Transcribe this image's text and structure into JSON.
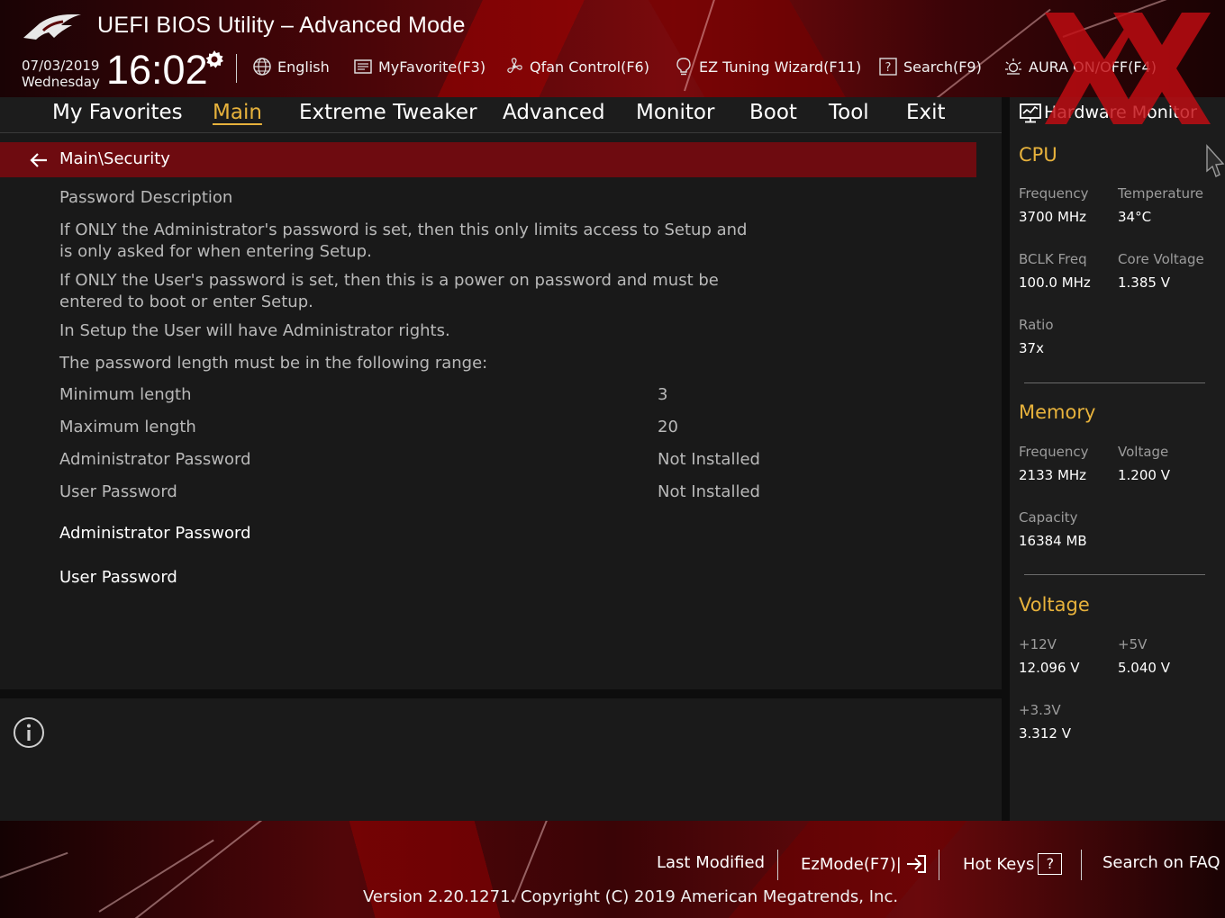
{
  "header": {
    "title": "UEFI BIOS Utility – Advanced Mode",
    "date": "07/03/2019",
    "weekday": "Wednesday",
    "time": "16:02",
    "tools": [
      {
        "label": "English",
        "icon": "globe-icon"
      },
      {
        "label": "MyFavorite(F3)",
        "icon": "favorite-list-icon"
      },
      {
        "label": "Qfan Control(F6)",
        "icon": "fan-icon"
      },
      {
        "label": "EZ Tuning Wizard(F11)",
        "icon": "lightbulb-icon"
      },
      {
        "label": "Search(F9)",
        "icon": "help-box-icon"
      },
      {
        "label": "AURA ON/OFF(F4)",
        "icon": "aura-light-icon"
      }
    ]
  },
  "menu": {
    "items": [
      "My Favorites",
      "Main",
      "Extreme Tweaker",
      "Advanced",
      "Monitor",
      "Boot",
      "Tool",
      "Exit"
    ],
    "active": "Main"
  },
  "main": {
    "breadcrumb": "Main\\Security",
    "description": {
      "title": "Password Description",
      "lines": [
        "If ONLY the Administrator's password is set, then this only limits access to Setup and",
        "is only asked for when entering Setup.",
        "If ONLY the User's password is set, then this is a power on password and must be",
        "entered to boot or enter Setup.",
        "In Setup the User will have Administrator rights.",
        "The password length must be in the following range:"
      ]
    },
    "rows": [
      {
        "label": "Minimum length",
        "value": "3"
      },
      {
        "label": "Maximum length",
        "value": "20"
      },
      {
        "label": "Administrator Password",
        "value": "Not Installed"
      },
      {
        "label": "User Password",
        "value": "Not Installed"
      }
    ],
    "actions": [
      "Administrator Password",
      "User Password"
    ]
  },
  "hardware_monitor": {
    "title": "Hardware Monitor",
    "cpu": {
      "heading": "CPU",
      "frequency_label": "Frequency",
      "frequency": "3700 MHz",
      "temperature_label": "Temperature",
      "temperature": "34°C",
      "bclk_label": "BCLK Freq",
      "bclk": "100.0 MHz",
      "core_voltage_label": "Core Voltage",
      "core_voltage": "1.385 V",
      "ratio_label": "Ratio",
      "ratio": "37x"
    },
    "memory": {
      "heading": "Memory",
      "frequency_label": "Frequency",
      "frequency": "2133 MHz",
      "voltage_label": "Voltage",
      "voltage": "1.200 V",
      "capacity_label": "Capacity",
      "capacity": "16384 MB"
    },
    "voltage": {
      "heading": "Voltage",
      "v12_label": "+12V",
      "v12": "12.096 V",
      "v5_label": "+5V",
      "v5": "5.040 V",
      "v33_label": "+3.3V",
      "v33": "3.312 V"
    }
  },
  "footer": {
    "last_modified": "Last Modified",
    "ezmode": "EzMode(F7)|",
    "hot_keys": "Hot Keys",
    "hot_keys_key": "?",
    "search_faq": "Search on FAQ",
    "copyright": "Version 2.20.1271. Copyright (C) 2019 American Megatrends, Inc."
  },
  "colors": {
    "accent": "#e7b23c",
    "breadcrumb_bar": "#6e0b10",
    "header_red": "#7a0a0d"
  }
}
